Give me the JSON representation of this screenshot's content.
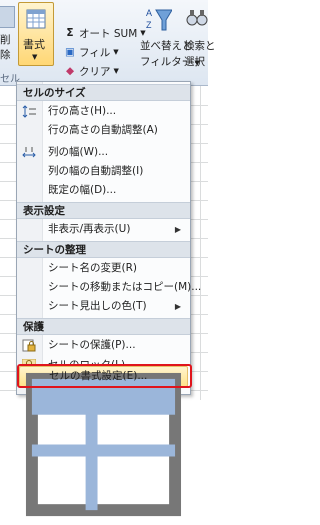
{
  "ribbon": {
    "left_partial_label": "削除",
    "left_group_partial": "セル",
    "format_button": "書式",
    "autosum": "オート SUM",
    "fill": "フィル",
    "clear": "クリア",
    "sort_filter_line1": "並べ替えと",
    "sort_filter_line2": "フィルター",
    "find_line1": "検索と",
    "find_line2": "選択"
  },
  "menu": {
    "sections": [
      {
        "header": "セルのサイズ",
        "items": [
          {
            "label": "行の高さ(H)...",
            "icon": "row-height-icon"
          },
          {
            "label": "行の高さの自動調整(A)",
            "icon": ""
          },
          {
            "label": "列の幅(W)...",
            "icon": "column-width-icon"
          },
          {
            "label": "列の幅の自動調整(I)",
            "icon": ""
          },
          {
            "label": "既定の幅(D)...",
            "icon": ""
          }
        ]
      },
      {
        "header": "表示設定",
        "items": [
          {
            "label": "非表示/再表示(U)",
            "icon": "",
            "submenu": true
          }
        ]
      },
      {
        "header": "シートの整理",
        "items": [
          {
            "label": "シート名の変更(R)",
            "icon": ""
          },
          {
            "label": "シートの移動またはコピー(M)...",
            "icon": ""
          },
          {
            "label": "シート見出しの色(T)",
            "icon": "",
            "submenu": true
          }
        ]
      },
      {
        "header": "保護",
        "items": [
          {
            "label": "シートの保護(P)...",
            "icon": "protect-sheet-icon"
          },
          {
            "label": "セルのロック(L)",
            "icon": "lock-icon"
          },
          {
            "label": "セルの書式設定(E)...",
            "icon": "format-cells-icon",
            "highlighted": true
          }
        ]
      }
    ]
  },
  "colors": {
    "highlight": "#ffe48a",
    "callout": "#e0141c",
    "section_header": "#dde3ea"
  }
}
